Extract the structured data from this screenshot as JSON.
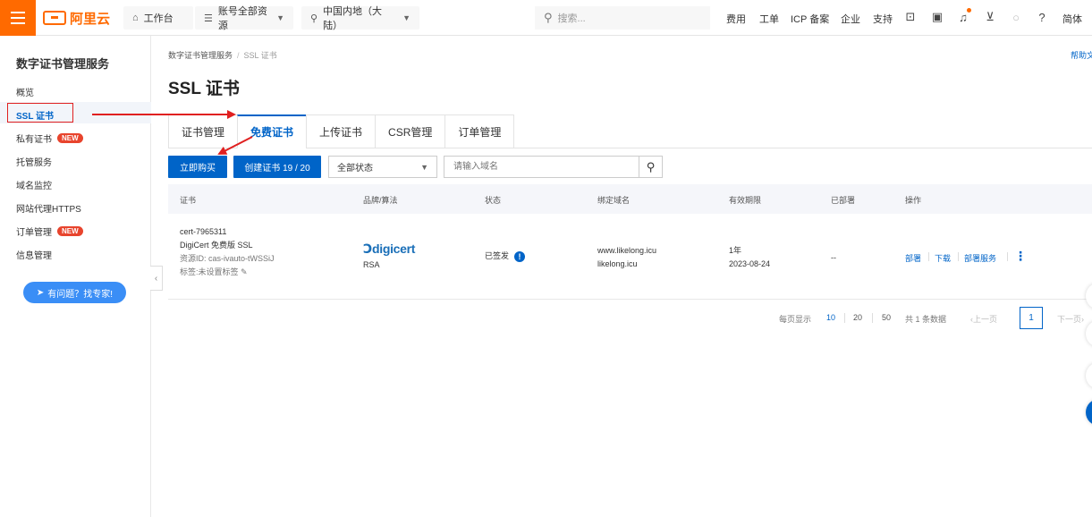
{
  "topbar": {
    "logo_text": "阿里云",
    "workbench": "工作台",
    "account_resources": "账号全部资源",
    "region": "中国内地（大陆）",
    "search_placeholder": "搜索...",
    "links": [
      "费用",
      "工单",
      "ICP 备案",
      "企业",
      "支持"
    ],
    "language": "简体"
  },
  "sidebar": {
    "title": "数字证书管理服务",
    "items": [
      {
        "label": "概览"
      },
      {
        "label": "SSL 证书"
      },
      {
        "label": "私有证书",
        "badge": "NEW"
      },
      {
        "label": "托管服务"
      },
      {
        "label": "域名监控"
      },
      {
        "label": "网站代理HTTPS"
      },
      {
        "label": "订单管理",
        "badge": "NEW"
      },
      {
        "label": "信息管理"
      }
    ],
    "help_button": "有问题？找专家!"
  },
  "breadcrumb": {
    "root": "数字证书管理服务",
    "current": "SSL 证书"
  },
  "help_doc": "帮助文",
  "page_title": "SSL 证书",
  "tabs": [
    "证书管理",
    "免费证书",
    "上传证书",
    "CSR管理",
    "订单管理"
  ],
  "toolbar": {
    "buy_now": "立即购买",
    "create_cert": "创建证书 19 / 20",
    "status_select": "全部状态",
    "domain_placeholder": "请输入域名"
  },
  "table": {
    "headers": [
      "证书",
      "品牌/算法",
      "状态",
      "绑定域名",
      "有效期限",
      "已部署",
      "操作"
    ],
    "row": {
      "cert_id": "cert-7965311",
      "cert_name": "DigiCert 免费版 SSL",
      "resource_id": "资源ID: cas-ivauto-tWSSiJ",
      "tag": "标签:未设置标签",
      "brand": "digicert",
      "algorithm": "RSA",
      "status": "已签发",
      "domain_1": "www.likelong.icu",
      "domain_2": "likelong.icu",
      "validity": "1年",
      "expiry": "2023-08-24",
      "deployed": "--",
      "ops": [
        "部署",
        "下载",
        "部署服务"
      ]
    }
  },
  "pagination": {
    "per_page_label": "每页显示",
    "sizes": [
      "10",
      "20",
      "50"
    ],
    "total": "共 1 条数据",
    "prev": "上一页",
    "page": "1",
    "next": "下一页"
  },
  "colors": {
    "brand": "#ff6a00",
    "primary": "#0064c8",
    "annotation": "#e02020"
  }
}
